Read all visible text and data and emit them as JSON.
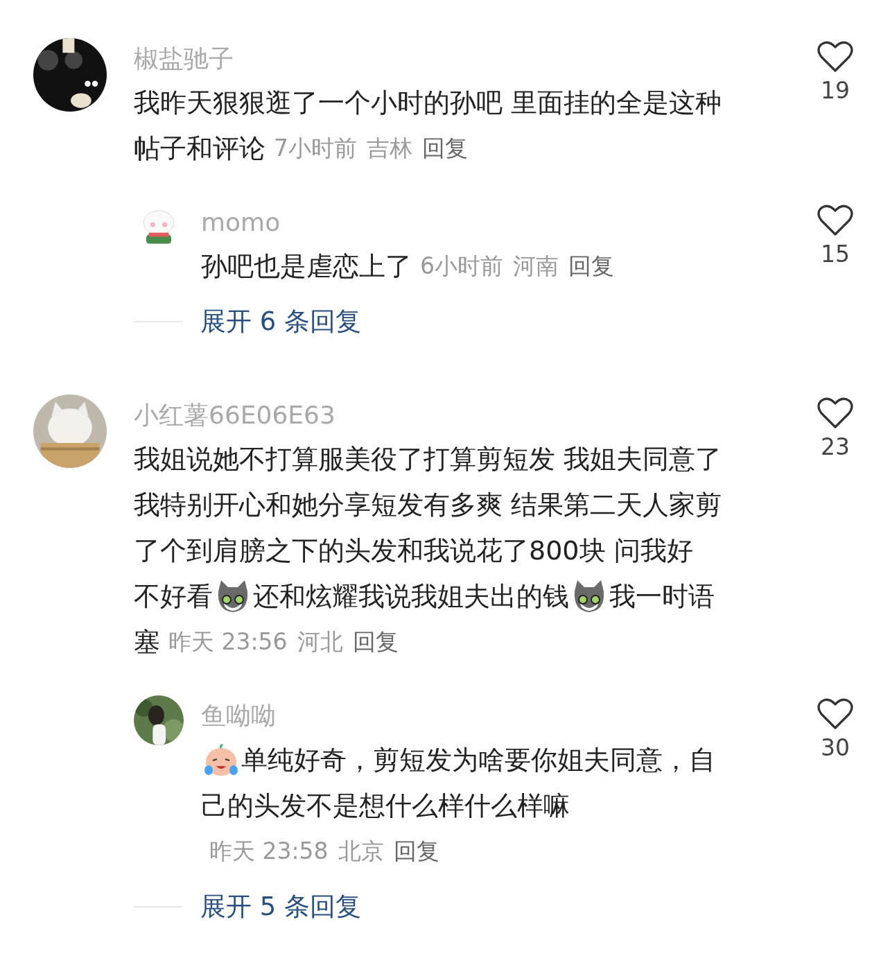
{
  "comments": [
    {
      "username": "椒盐驰子",
      "lines": [
        [
          {
            "kind": "text",
            "text": "我昨天狠狠逛了一个小时的孙吧 里面挂的全是这种"
          }
        ],
        [
          {
            "kind": "text",
            "text": "帖子和评论"
          }
        ]
      ],
      "time": "7小时前",
      "location": "吉林",
      "reply_label": "回复",
      "likes": "19",
      "replies": [
        {
          "username": "momo",
          "lines": [
            [
              {
                "kind": "text",
                "text": "孙吧也是虐恋上了"
              }
            ]
          ],
          "time": "6小时前",
          "location": "河南",
          "reply_label": "回复",
          "likes": "15"
        }
      ],
      "expand": "展开 6 条回复"
    },
    {
      "username": "小红薯66E06E63",
      "lines": [
        [
          {
            "kind": "text",
            "text": "我姐说她不打算服美役了打算剪短发 我姐夫同意了"
          }
        ],
        [
          {
            "kind": "text",
            "text": "我特别开心和她分享短发有多爽 结果第二天人家剪"
          }
        ],
        [
          {
            "kind": "text",
            "text": "了个到肩膀之下的头发和我说花了800块 问我好"
          }
        ],
        [
          {
            "kind": "text",
            "text": "不好看"
          },
          {
            "kind": "cat"
          },
          {
            "kind": "text",
            "text": "还和炫耀我说我姐夫出的钱"
          },
          {
            "kind": "cat"
          },
          {
            "kind": "text",
            "text": "我一时语"
          }
        ],
        [
          {
            "kind": "text",
            "text": "塞"
          }
        ]
      ],
      "time": "昨天 23:56",
      "location": "河北",
      "reply_label": "回复",
      "likes": "23",
      "replies": [
        {
          "username": "鱼呦呦",
          "lines": [
            [
              {
                "kind": "crying"
              },
              {
                "kind": "text",
                "text": "单纯好奇，剪短发为啥要你姐夫同意，自"
              }
            ],
            [
              {
                "kind": "text",
                "text": "己的头发不是想什么样什么样嘛"
              }
            ]
          ],
          "time": "昨天 23:58",
          "location": "北京",
          "reply_label": "回复",
          "likes": "30"
        }
      ],
      "expand": "展开 5 条回复"
    }
  ]
}
